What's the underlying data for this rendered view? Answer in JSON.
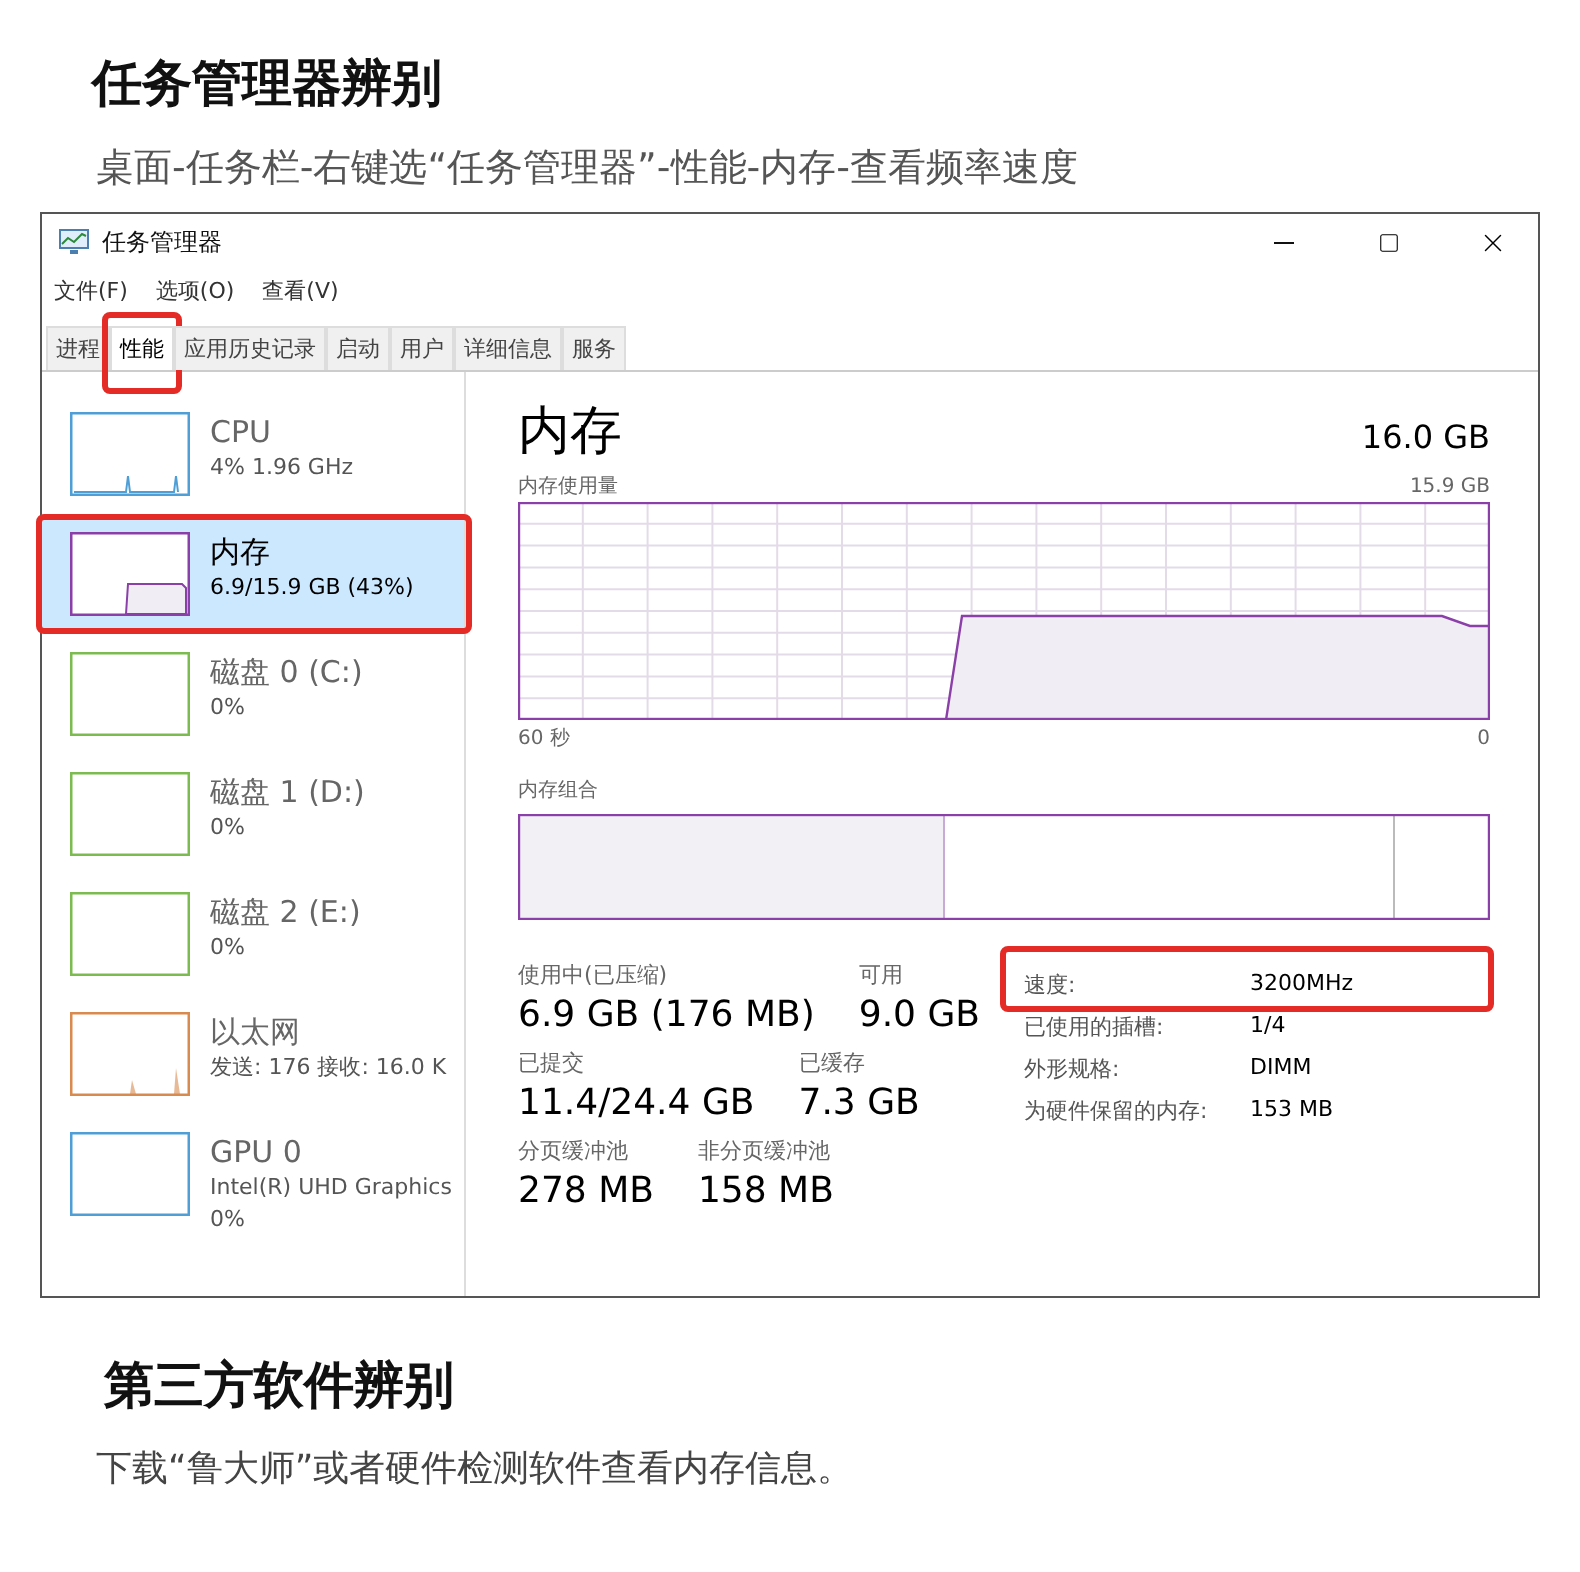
{
  "heading": "任务管理器辨别",
  "subtitle": "桌面-任务栏-右键选“任务管理器”-性能-内存-查看频率速度",
  "window": {
    "title": "任务管理器",
    "menu": [
      {
        "label": "文件(F)"
      },
      {
        "label": "选项(O)"
      },
      {
        "label": "查看(V)"
      }
    ],
    "tabs": [
      {
        "label": "进程",
        "selected": false,
        "highlighted": false
      },
      {
        "label": "性能",
        "selected": true,
        "highlighted": true
      },
      {
        "label": "应用历史记录",
        "selected": false,
        "highlighted": false
      },
      {
        "label": "启动",
        "selected": false,
        "highlighted": false
      },
      {
        "label": "用户",
        "selected": false,
        "highlighted": false
      },
      {
        "label": "详细信息",
        "selected": false,
        "highlighted": false
      },
      {
        "label": "服务",
        "selected": false,
        "highlighted": false
      }
    ],
    "sidebar": {
      "items": [
        {
          "kind": "cpu",
          "name": "CPU",
          "lines": [
            "4% 1.96 GHz"
          ],
          "color": "#4f9fd6",
          "selected": false,
          "highlighted": false
        },
        {
          "kind": "memory",
          "name": "内存",
          "lines": [
            "6.9/15.9 GB (43%)"
          ],
          "color": "#8b3fa8",
          "selected": true,
          "highlighted": true
        },
        {
          "kind": "disk",
          "name": "磁盘 0 (C:)",
          "lines": [
            "0%"
          ],
          "color": "#7cbb4f",
          "selected": false,
          "highlighted": false
        },
        {
          "kind": "disk",
          "name": "磁盘 1 (D:)",
          "lines": [
            "0%"
          ],
          "color": "#7cbb4f",
          "selected": false,
          "highlighted": false
        },
        {
          "kind": "disk",
          "name": "磁盘 2 (E:)",
          "lines": [
            "0%"
          ],
          "color": "#7cbb4f",
          "selected": false,
          "highlighted": false
        },
        {
          "kind": "network",
          "name": "以太网",
          "lines": [
            "发送: 176 接收: 16.0 K"
          ],
          "color": "#d98a4f",
          "selected": false,
          "highlighted": false
        },
        {
          "kind": "gpu",
          "name": "GPU 0",
          "lines": [
            "Intel(R) UHD Graphics",
            "0%"
          ],
          "color": "#4f9fd6",
          "selected": false,
          "highlighted": false
        }
      ]
    },
    "panel": {
      "title": "内存",
      "total": "16.0 GB",
      "usage_label": "内存使用量",
      "usage_max": "15.9 GB",
      "time_start": "60 秒",
      "time_end": "0",
      "composition_label": "内存组合",
      "stats": [
        [
          {
            "label": "使用中(已压缩)",
            "value": "6.9 GB (176 MB)"
          },
          {
            "label": "可用",
            "value": "9.0 GB"
          }
        ],
        [
          {
            "label": "已提交",
            "value": "11.4/24.4 GB"
          },
          {
            "label": "已缓存",
            "value": "7.3 GB"
          }
        ],
        [
          {
            "label": "分页缓冲池",
            "value": "278 MB"
          },
          {
            "label": "非分页缓冲池",
            "value": "158 MB"
          }
        ]
      ],
      "details": [
        {
          "label": "速度:",
          "value": "3200MHz",
          "highlighted": true
        },
        {
          "label": "已使用的插槽:",
          "value": "1/4",
          "highlighted": false
        },
        {
          "label": "外形规格:",
          "value": "DIMM",
          "highlighted": false
        },
        {
          "label": "为硬件保留的内存:",
          "value": "153 MB",
          "highlighted": false
        }
      ]
    }
  },
  "heading_2": "第三方软件辨别",
  "subtitle_2": "下载“鲁大师”或者硬件检测软件查看内存信息。"
}
